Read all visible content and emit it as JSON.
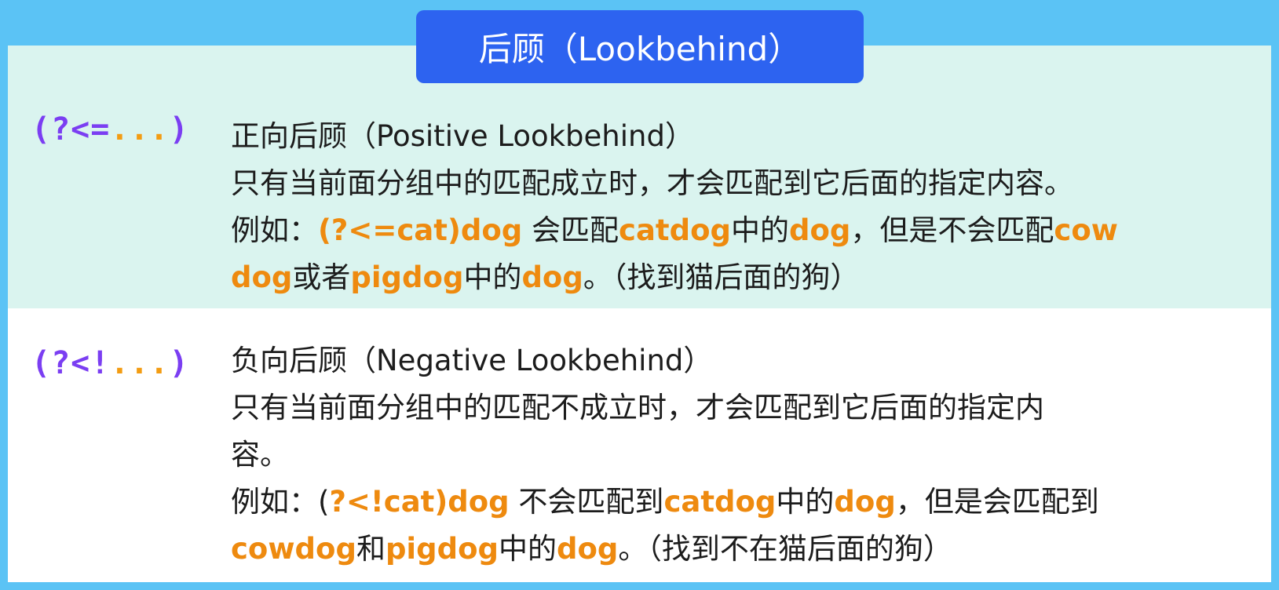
{
  "title": "后顾（Lookbehind）",
  "colors": {
    "frame": "#5bc3f5",
    "title_bg": "#2d63f0",
    "positive_bg": "#daf4ef",
    "paren": "#7b3ef2",
    "highlight": "#ee8a0f"
  },
  "positive": {
    "syntax": {
      "open": "(?<=",
      "dots": "...",
      "close": ")"
    },
    "heading": "正向后顾（Positive Lookbehind）",
    "description": "只有当前面分组中的匹配成立时，才会匹配到它后面的指定内容。",
    "example": {
      "prefix": "例如：",
      "pattern": "(?<=cat)dog",
      "t1": " 会匹配",
      "w1": "catdog",
      "t2": "中的",
      "w2": "dog",
      "t3": "，但是不会匹配",
      "w3a": "cow",
      "w3b": "dog",
      "t4": "或者",
      "w4": "pigdog",
      "t5": "中的",
      "w5": "dog",
      "t6": "。（找到猫后面的狗）"
    }
  },
  "negative": {
    "syntax": {
      "open": "(?<!",
      "dots": "...",
      "close": ")"
    },
    "heading": "负向后顾（Negative Lookbehind）",
    "description_line1": "只有当前面分组中的匹配不成立时，才会匹配到它后面的指定内",
    "description_line2": "容。",
    "example": {
      "prefix": "例如：(",
      "pattern": "?<!cat)dog",
      "t1": " 不会匹配到",
      "w1": "catdog",
      "t2": "中的",
      "w2": "dog",
      "t3": "，但是会匹配到",
      "w3": "cowdog",
      "t4": "和",
      "w4": "pigdog",
      "t5": "中的",
      "w5": "dog",
      "t6": "。（找到不在猫后面的狗）"
    }
  }
}
